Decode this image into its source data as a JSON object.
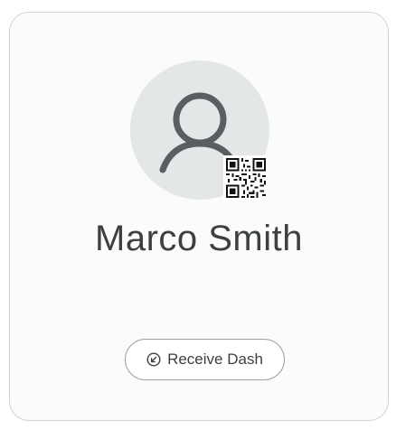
{
  "profile": {
    "name": "Marco Smith",
    "avatar_icon": "user-icon",
    "qr_icon": "qr-code-icon"
  },
  "actions": {
    "receive_label": "Receive Dash",
    "receive_icon": "arrow-down-left-circle-icon"
  },
  "colors": {
    "card_border": "#cfd1d3",
    "avatar_bg": "#e3e7e7",
    "icon_stroke": "#5a5e60",
    "text": "#3d4042",
    "button_border": "#9da1a4"
  }
}
